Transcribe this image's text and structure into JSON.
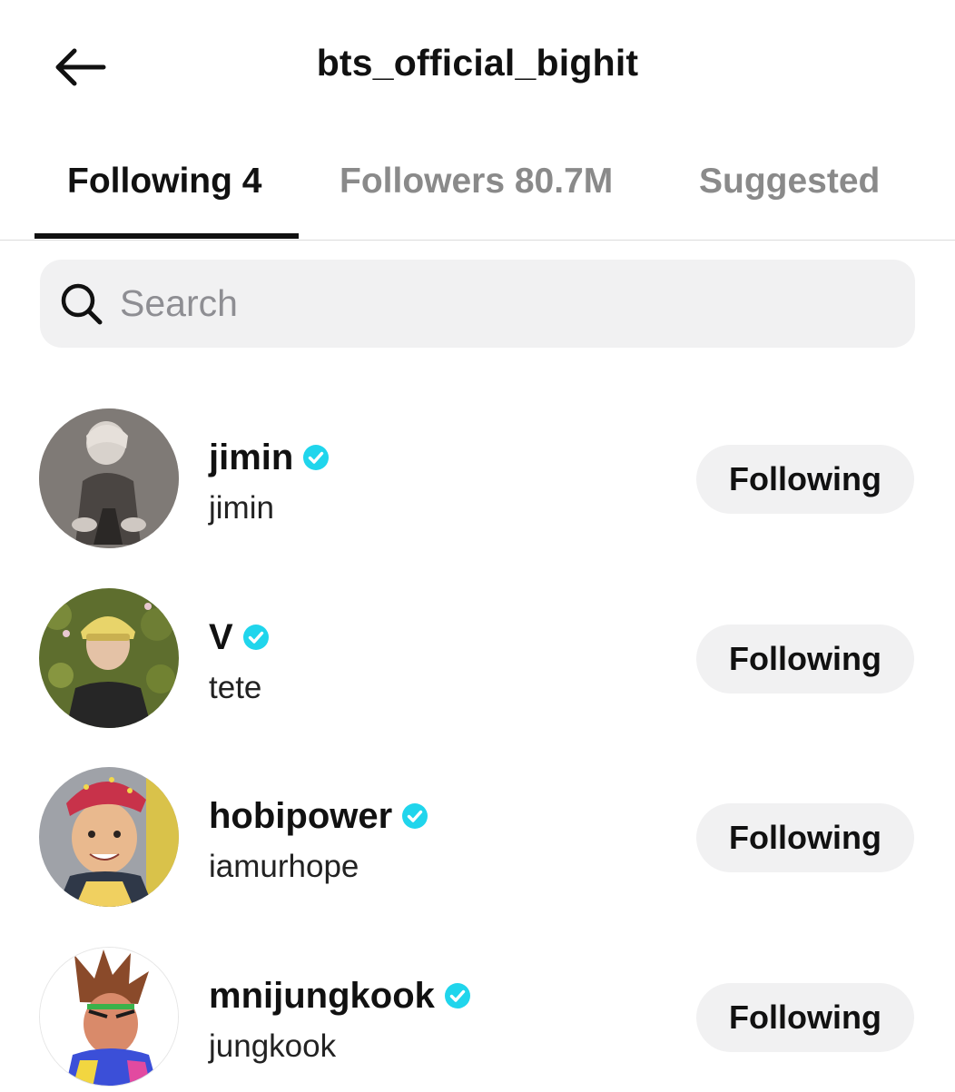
{
  "header": {
    "title": "bts_official_bighit"
  },
  "tabs": [
    {
      "label": "Following 4",
      "active": true
    },
    {
      "label": "Followers 80.7M",
      "active": false
    },
    {
      "label": "Suggested",
      "active": false
    }
  ],
  "search": {
    "placeholder": "Search",
    "value": ""
  },
  "accounts": [
    {
      "name": "jimin",
      "handle": "jimin",
      "verified": true,
      "button_label": "Following"
    },
    {
      "name": "V",
      "handle": "tete",
      "verified": true,
      "button_label": "Following"
    },
    {
      "name": "hobipower",
      "handle": "iamurhope",
      "verified": true,
      "button_label": "Following"
    },
    {
      "name": "mnijungkook",
      "handle": "jungkook",
      "verified": true,
      "button_label": "Following"
    }
  ],
  "colors": {
    "verified": "#20d5ec",
    "active_tab": "#111111",
    "inactive_tab": "#8a8a8a",
    "pill_background": "#f1f1f2"
  },
  "icons": {
    "back": "arrow-left-icon",
    "search": "search-icon",
    "verified": "verified-badge-icon"
  }
}
